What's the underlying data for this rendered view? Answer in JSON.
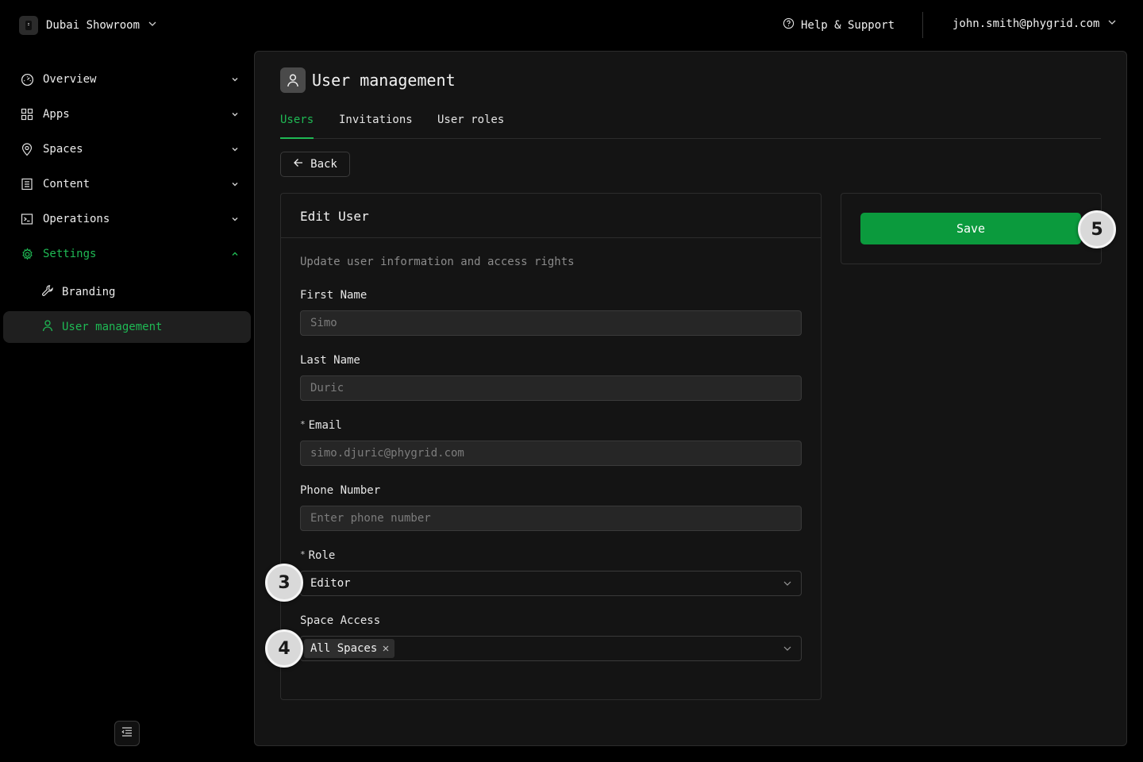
{
  "workspace": {
    "name": "Dubai Showroom"
  },
  "header": {
    "help_label": "Help & Support",
    "account_email": "john.smith@phygrid.com"
  },
  "sidebar": {
    "items": [
      {
        "label": "Overview",
        "icon": "gauge-icon"
      },
      {
        "label": "Apps",
        "icon": "grid-icon"
      },
      {
        "label": "Spaces",
        "icon": "map-pin-icon"
      },
      {
        "label": "Content",
        "icon": "content-icon"
      },
      {
        "label": "Operations",
        "icon": "terminal-icon"
      },
      {
        "label": "Settings",
        "icon": "gear-icon"
      }
    ],
    "sub_items": [
      {
        "label": "Branding",
        "icon": "wrench-icon"
      },
      {
        "label": "User management",
        "icon": "user-icon"
      }
    ]
  },
  "page": {
    "title": "User management",
    "tabs": [
      {
        "label": "Users"
      },
      {
        "label": "Invitations"
      },
      {
        "label": "User roles"
      }
    ],
    "back_label": "Back"
  },
  "form": {
    "title": "Edit User",
    "description": "Update user information and access rights",
    "first_name": {
      "label": "First Name",
      "value": "Simo"
    },
    "last_name": {
      "label": "Last Name",
      "value": "Duric"
    },
    "email": {
      "label": "Email",
      "required_mark": "*",
      "value": "simo.djuric@phygrid.com"
    },
    "phone": {
      "label": "Phone Number",
      "placeholder": "Enter phone number"
    },
    "role": {
      "label": "Role",
      "required_mark": "*",
      "value": "Editor"
    },
    "space_access": {
      "label": "Space Access",
      "tag": "All Spaces"
    }
  },
  "actions": {
    "save_label": "Save"
  },
  "badges": {
    "role": "3",
    "space": "4",
    "save": "5"
  },
  "colors": {
    "accent": "#1fb954",
    "save_button": "#0b9a3d"
  }
}
